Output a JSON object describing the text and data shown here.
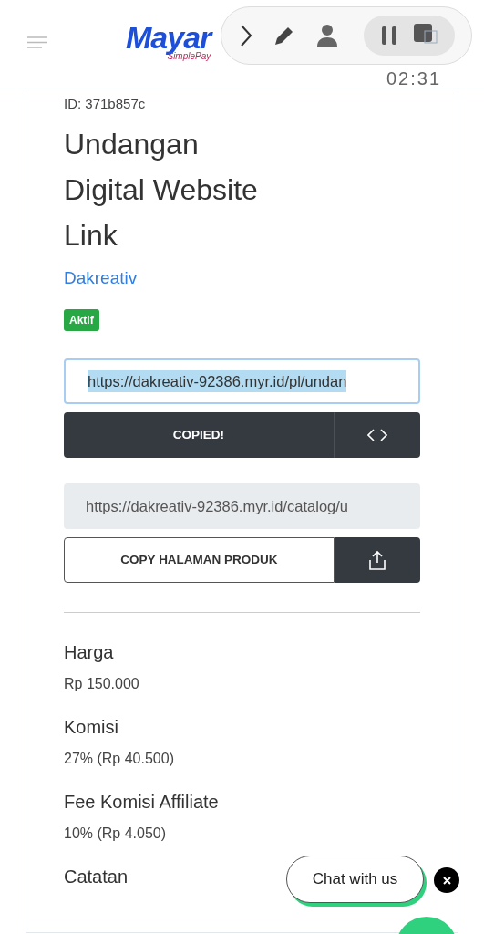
{
  "header": {
    "logo": "Mayar",
    "logo_tagline": "SimplePay"
  },
  "recorder": {
    "timer": "02:31"
  },
  "product": {
    "id": "ID: 371b857c",
    "title": "Undangan Digital Website Link",
    "seller": "Dakreativ",
    "status": {
      "label": "Aktif",
      "color": "#28a745"
    }
  },
  "payment_link": {
    "value": "https://dakreativ-92386.myr.id/pl/undan",
    "selected": true,
    "copy_button": "COPIED!"
  },
  "product_page": {
    "value": "https://dakreativ-92386.myr.id/catalog/u",
    "selected": false,
    "copy_button": "COPY HALAMAN PRODUK"
  },
  "details": [
    {
      "label": "Harga",
      "value": "Rp 150.000"
    },
    {
      "label": "Komisi",
      "value": "27% (Rp 40.500)"
    },
    {
      "label": "Fee Komisi Affiliate",
      "value": "10% (Rp 4.050)"
    },
    {
      "label": "Catatan"
    }
  ],
  "chat": {
    "label": "Chat with us"
  }
}
